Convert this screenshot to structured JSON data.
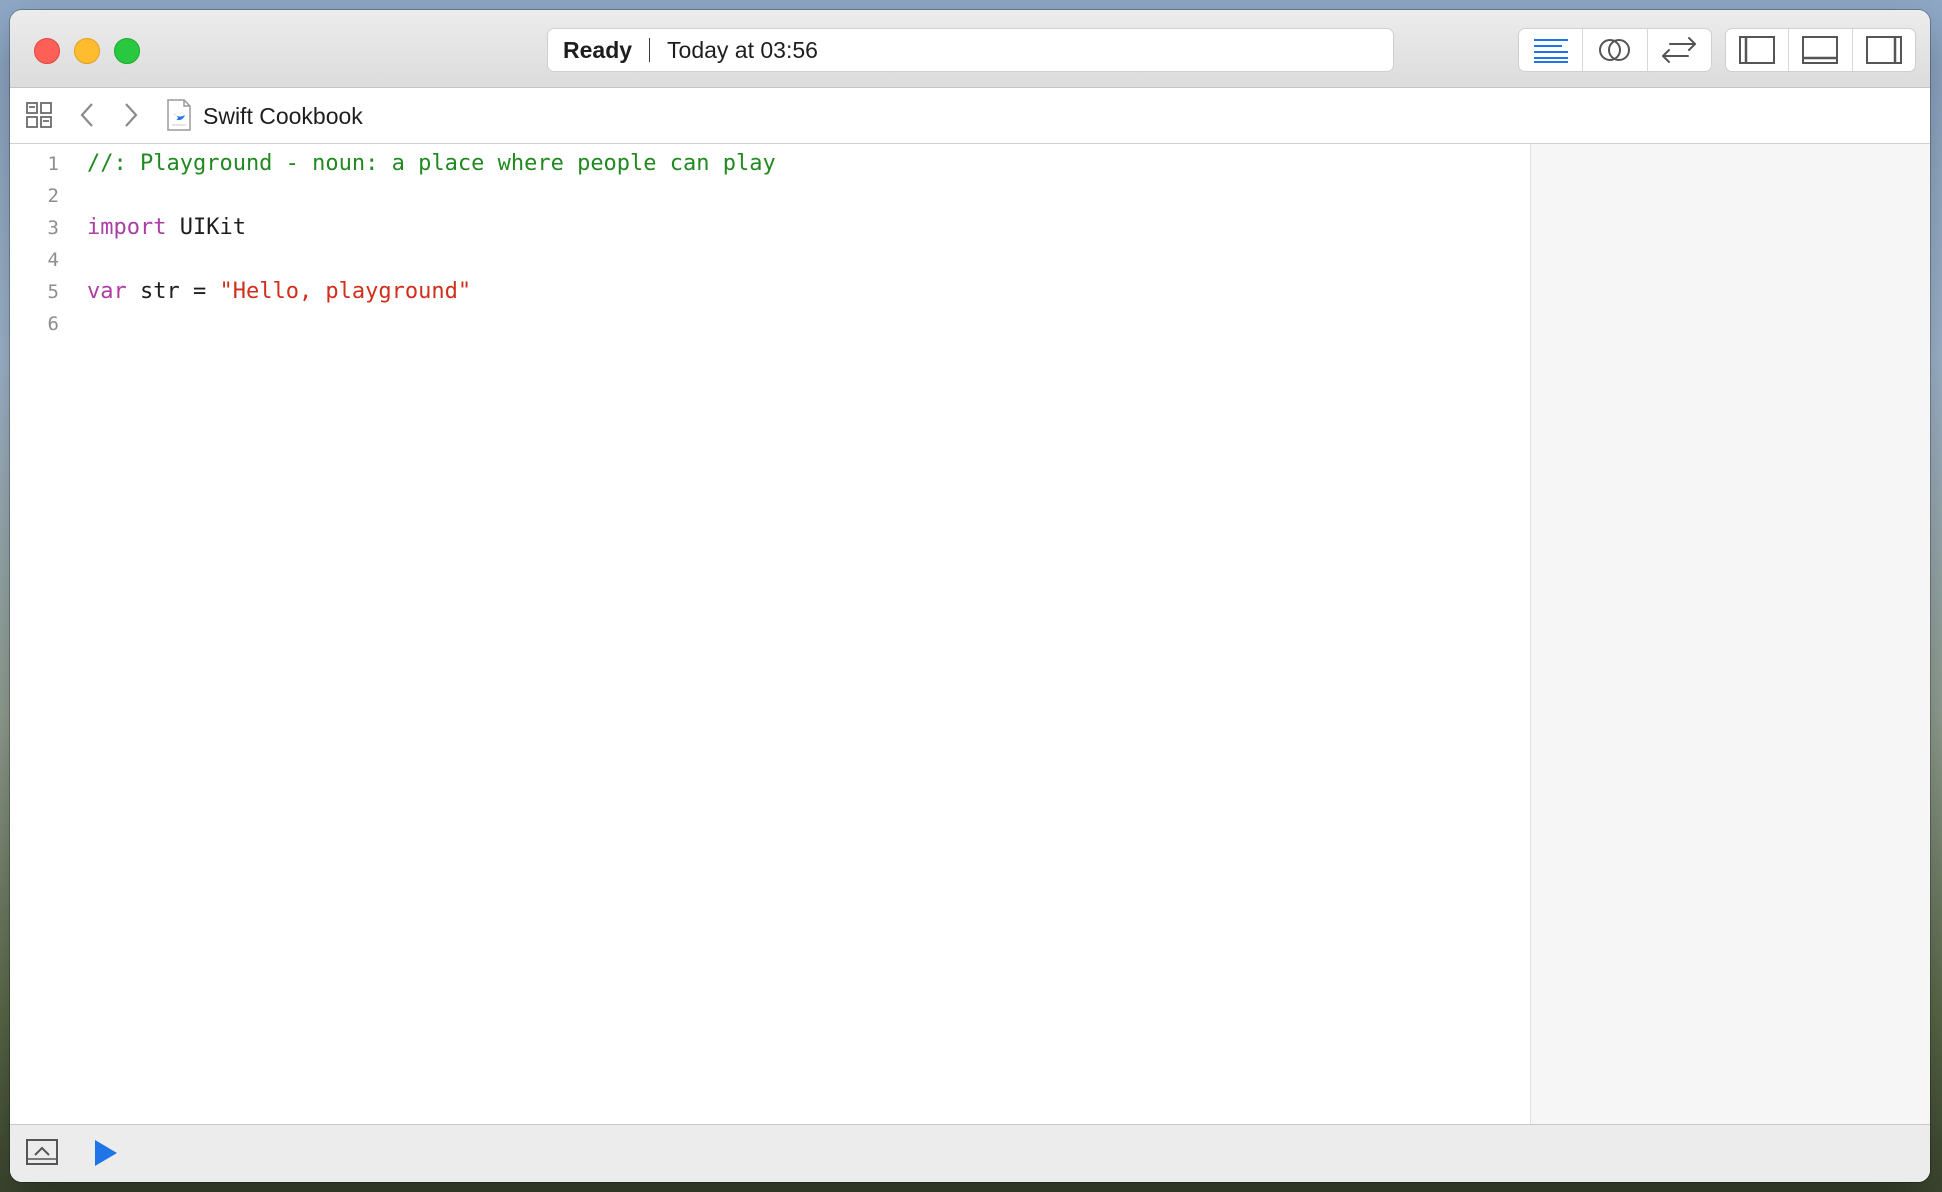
{
  "titlebar": {
    "status": "Ready",
    "timestamp": "Today at 03:56"
  },
  "toolbar": {
    "editor_modes": [
      "standard-editor-icon",
      "assistant-editor-icon",
      "version-editor-icon"
    ],
    "view_toggles": [
      "navigator-toggle-icon",
      "debug-area-toggle-icon",
      "inspector-toggle-icon"
    ],
    "accent_color": "#1f74e8"
  },
  "jumpbar": {
    "file_name": "Swift Cookbook"
  },
  "editor": {
    "lines": [
      {
        "number": "1",
        "tokens": [
          {
            "text": "//: Playground - noun: a place where people can play",
            "kind": "comment"
          }
        ]
      },
      {
        "number": "2",
        "tokens": []
      },
      {
        "number": "3",
        "tokens": [
          {
            "text": "import",
            "kind": "kw"
          },
          {
            "text": " UIKit",
            "kind": "plain"
          }
        ]
      },
      {
        "number": "4",
        "tokens": []
      },
      {
        "number": "5",
        "tokens": [
          {
            "text": "var",
            "kind": "kw"
          },
          {
            "text": " str = ",
            "kind": "plain"
          },
          {
            "text": "\"Hello, playground\"",
            "kind": "str"
          }
        ]
      },
      {
        "number": "6",
        "tokens": []
      }
    ]
  },
  "bottombar": {
    "run_color": "#1f74e8"
  }
}
